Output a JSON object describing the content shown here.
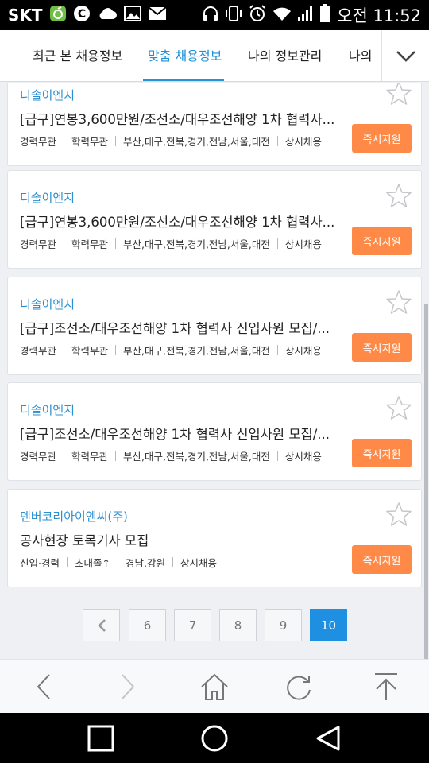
{
  "status_bar": {
    "carrier": "SKT",
    "time": "오전 11:52",
    "left_icons": [
      "hangouts-icon",
      "c-app-icon",
      "cloud-icon",
      "image-icon",
      "mail-icon"
    ],
    "right_icons": [
      "headphones-icon",
      "vibrate-icon",
      "alarm-icon",
      "wifi-icon",
      "signal-icon",
      "battery-icon"
    ]
  },
  "tabs": [
    {
      "label": "최근 본 채용정보",
      "active": false
    },
    {
      "label": "맞춤 채용정보",
      "active": true
    },
    {
      "label": "나의 정보관리",
      "active": false
    },
    {
      "label": "나의",
      "active": false
    }
  ],
  "colors": {
    "accent_blue": "#2a93d8",
    "apply_orange": "#ff8a48",
    "company_blue": "#2c8fd0",
    "active_page_blue": "#1e8fe1"
  },
  "jobs": [
    {
      "company": "디솔이엔지",
      "title": "[급구]연봉3,600만원/조선소/대우조선해양 1차 협력사...",
      "meta": [
        "경력무관",
        "학력무관",
        "부산,대구,전북,경기,전남,서울,대전",
        "상시채용"
      ],
      "apply_label": "즉시지원"
    },
    {
      "company": "디솔이엔지",
      "title": "[급구]연봉3,600만원/조선소/대우조선해양 1차 협력사...",
      "meta": [
        "경력무관",
        "학력무관",
        "부산,대구,전북,경기,전남,서울,대전",
        "상시채용"
      ],
      "apply_label": "즉시지원"
    },
    {
      "company": "디솔이엔지",
      "title": "[급구]조선소/대우조선해양 1차 협력사 신입사원 모집/...",
      "meta": [
        "경력무관",
        "학력무관",
        "부산,대구,전북,경기,전남,서울,대전",
        "상시채용"
      ],
      "apply_label": "즉시지원"
    },
    {
      "company": "디솔이엔지",
      "title": "[급구]조선소/대우조선해양 1차 협력사 신입사원 모집/...",
      "meta": [
        "경력무관",
        "학력무관",
        "부산,대구,전북,경기,전남,서울,대전",
        "상시채용"
      ],
      "apply_label": "즉시지원"
    },
    {
      "company": "덴버코리아이엔씨(주)",
      "title": "공사현장 토목기사 모집",
      "meta": [
        "신입·경력",
        "초대졸↑",
        "경남,강원",
        "상시채용"
      ],
      "apply_label": "즉시지원"
    }
  ],
  "pagination": {
    "prev_icon": "chevron-left-icon",
    "pages": [
      "6",
      "7",
      "8",
      "9",
      "10"
    ],
    "current": "10"
  },
  "browser_bar": [
    "back-icon",
    "forward-icon",
    "home-icon",
    "refresh-icon",
    "scroll-top-icon"
  ],
  "system_nav": [
    "recents-icon",
    "home-circle-icon",
    "back-triangle-icon"
  ]
}
